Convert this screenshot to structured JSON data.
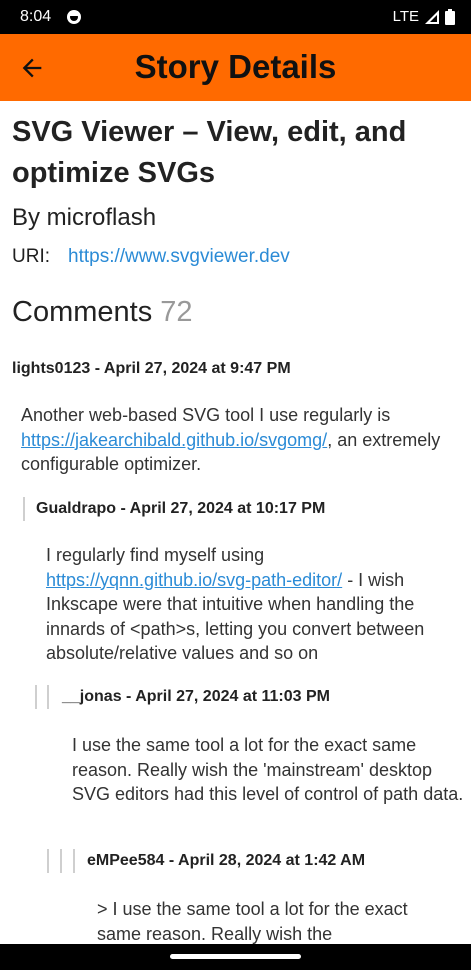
{
  "status_bar": {
    "time": "8:04",
    "network": "LTE"
  },
  "app_bar": {
    "title": "Story Details"
  },
  "story": {
    "title": "SVG Viewer – View, edit, and optimize SVGs",
    "author": "By microflash",
    "uri_label": "URI:",
    "uri": "https://www.svgviewer.dev"
  },
  "comments": {
    "heading": "Comments",
    "count": "72",
    "items": [
      {
        "header": "lights0123 - April 27, 2024 at 9:47 PM",
        "body_before": "Another web-based SVG tool I use regularly is ",
        "link": "https://jakearchibald.github.io/svgomg/",
        "body_after": ", an extremely configurable optimizer."
      },
      {
        "header": "Gualdrapo - April 27, 2024 at 10:17 PM",
        "body_before": "I regularly find myself using ",
        "link": "https://yqnn.github.io/svg-path-editor/",
        "body_after": " - I wish Inkscape were that intuitive when handling the innards of <path>s, letting you convert between absolute/relative values and so on"
      },
      {
        "header": "__jonas - April 27, 2024 at 11:03 PM",
        "body": "I use the same tool a lot for the exact same reason. Really wish the 'mainstream' desktop SVG editors had this level of control of path data."
      },
      {
        "header": "eMPee584 - April 28, 2024 at 1:42 AM",
        "body": "> I use the same tool a lot for the exact same reason. Really wish the"
      }
    ]
  }
}
